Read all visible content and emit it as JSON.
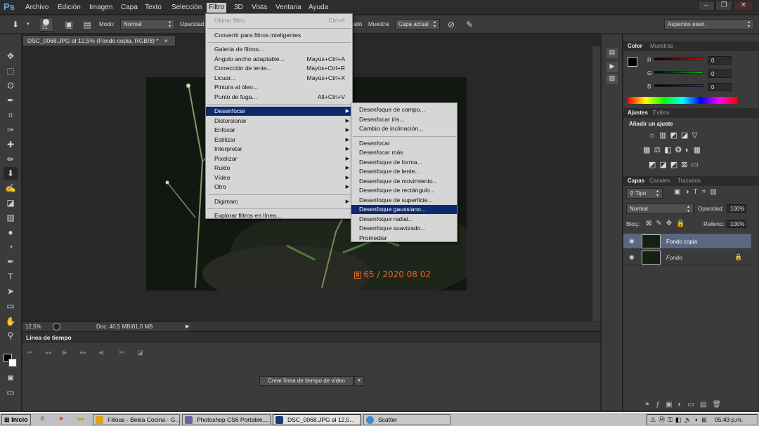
{
  "app": {
    "logo": "Ps"
  },
  "menubar": [
    "Archivo",
    "Edición",
    "Imagen",
    "Capa",
    "Texto",
    "Selección",
    "Filtro",
    "3D",
    "Vista",
    "Ventana",
    "Ayuda"
  ],
  "window_controls": [
    "–",
    "❐",
    "✕"
  ],
  "options": {
    "brush_size": "21",
    "mode_label": "Modo:",
    "mode_value": "Normal",
    "opacity_label": "Opacidad:",
    "flow_partial": "ado",
    "sample_label": "Muestra:",
    "sample_value": "Capa actual",
    "workspace_value": "Aspectos esen."
  },
  "document": {
    "tab_title": "DSC_0068.JPG al 12,5% (Fondo copia, RGB/8) *",
    "tab_close": "×",
    "date_stamp": "65 / 2020 08 02",
    "zoom": "12,5%",
    "doc_size": "Doc: 40,5 MB/81,0 MB"
  },
  "timeline": {
    "title": "Línea de tiempo",
    "create_button": "Crear línea de tiempo de vídeo",
    "dropdown_icon": "▾"
  },
  "filter_menu": [
    {
      "label": "Último filtro",
      "shortcut": "Ctrl+F",
      "disabled": true
    },
    {
      "sep": true
    },
    {
      "label": "Convertir para filtros inteligentes"
    },
    {
      "sep": true
    },
    {
      "label": "Galería de filtros..."
    },
    {
      "label": "Ángulo ancho adaptable...",
      "shortcut": "Mayús+Ctrl+A"
    },
    {
      "label": "Corrección de lente...",
      "shortcut": "Mayús+Ctrl+R"
    },
    {
      "label": "Licuar...",
      "shortcut": "Mayús+Ctrl+X"
    },
    {
      "label": "Pintura al óleo..."
    },
    {
      "label": "Punto de fuga...",
      "shortcut": "Alt+Ctrl+V"
    },
    {
      "sep": true
    },
    {
      "label": "Desenfocar",
      "submenu": true,
      "highlight": true
    },
    {
      "label": "Distorsionar",
      "submenu": true
    },
    {
      "label": "Enfocar",
      "submenu": true
    },
    {
      "label": "Estilizar",
      "submenu": true
    },
    {
      "label": "Interpretar",
      "submenu": true
    },
    {
      "label": "Pixelizar",
      "submenu": true
    },
    {
      "label": "Ruido",
      "submenu": true
    },
    {
      "label": "Vídeo",
      "submenu": true
    },
    {
      "label": "Otro",
      "submenu": true
    },
    {
      "sep": true
    },
    {
      "label": "Digimarc",
      "submenu": true
    },
    {
      "sep": true
    },
    {
      "label": "Explorar filtros en línea..."
    }
  ],
  "blur_submenu": [
    {
      "label": "Desenfoque de campo..."
    },
    {
      "label": "Desenfocar iris..."
    },
    {
      "label": "Cambio de inclinación..."
    },
    {
      "sep": true
    },
    {
      "label": "Desenfocar"
    },
    {
      "label": "Desenfocar más"
    },
    {
      "label": "Desenfoque de forma..."
    },
    {
      "label": "Desenfoque de lente..."
    },
    {
      "label": "Desenfoque de movimiento..."
    },
    {
      "label": "Desenfoque de rectángulo..."
    },
    {
      "label": "Desenfoque de superficie..."
    },
    {
      "label": "Desenfoque gaussiano...",
      "highlight": true
    },
    {
      "label": "Desenfoque radial..."
    },
    {
      "label": "Desenfoque suavizado..."
    },
    {
      "label": "Promediar"
    }
  ],
  "color_panel": {
    "tabs": [
      "Color",
      "Muestras"
    ],
    "channels": [
      {
        "name": "R",
        "value": "0",
        "color": "#d01010"
      },
      {
        "name": "G",
        "value": "0",
        "color": "#10b010"
      },
      {
        "name": "B",
        "value": "0",
        "color": "#1030d0"
      }
    ]
  },
  "adjust_panel": {
    "tabs": [
      "Ajustes",
      "Estilos"
    ],
    "heading": "Añadir un ajuste"
  },
  "layers_panel": {
    "tabs": [
      "Capas",
      "Canales",
      "Trazados"
    ],
    "kind": "Tipo",
    "blend": "Normal",
    "opacity_label": "Opacidad:",
    "opacity": "100%",
    "lock_label": "Bloq.:",
    "fill_label": "Relleno:",
    "fill": "100%",
    "layers": [
      {
        "name": "Fondo copia",
        "selected": true
      },
      {
        "name": "Fondo",
        "locked": true
      }
    ]
  },
  "taskbar": {
    "start": "Inicio",
    "tasks": [
      {
        "label": "Filloas - Bekia Cocina - G...",
        "color": "#e0a020"
      },
      {
        "label": "Photoshop CS6 Portable....",
        "color": "#7060a0"
      },
      {
        "label": "DSC_0068.JPG al 12,5...",
        "color": "#1c3a78",
        "active": true
      },
      {
        "label": "Scatter",
        "color": "#3a8ad8"
      }
    ],
    "time": "05:43 p.m."
  }
}
